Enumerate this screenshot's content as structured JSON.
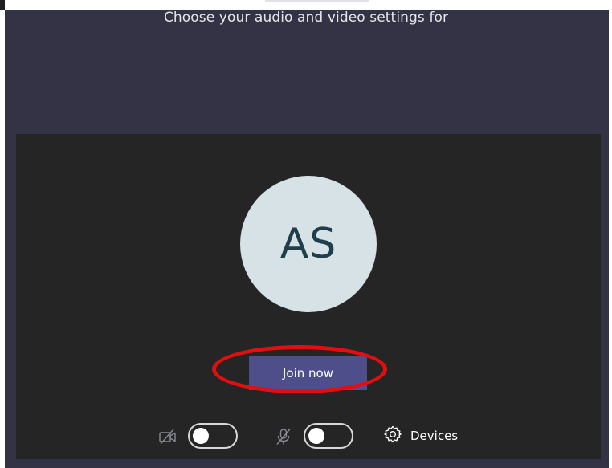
{
  "prejoin": {
    "heading": "Choose your audio and video settings for"
  },
  "avatar": {
    "initials": "AS"
  },
  "join": {
    "label": "Join now"
  },
  "controls": {
    "camera_icon": "camera-off-icon",
    "camera_toggle_state": "off",
    "mic_icon": "mic-off-icon",
    "mic_toggle_state": "off",
    "devices_icon": "gear-icon",
    "devices_label": "Devices"
  },
  "colors": {
    "window_bg": "#343345",
    "preview_bg": "#252525",
    "avatar_bg": "#d6e2e6",
    "avatar_text": "#1f3e4a",
    "join_button_bg": "#4e4f8a",
    "annotation_ring": "#e10f0f"
  }
}
